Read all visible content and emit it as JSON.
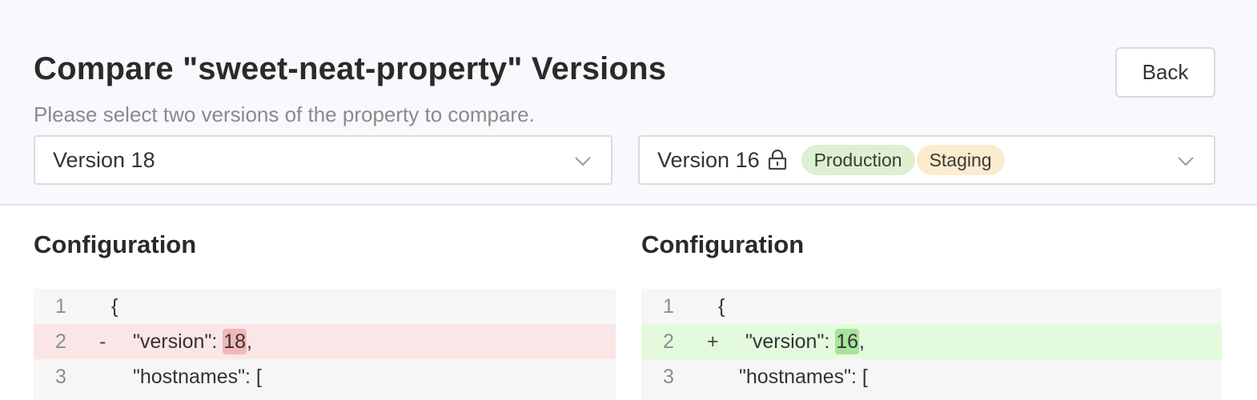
{
  "header": {
    "title": "Compare \"sweet-neat-property\" Versions",
    "subtitle": "Please select two versions of the property to compare.",
    "back_label": "Back"
  },
  "left_select": {
    "value": "Version 18",
    "icon": "chevron-down-icon"
  },
  "right_select": {
    "value": "Version 16",
    "lock_icon": "lock-icon",
    "tags": [
      "Production",
      "Staging"
    ],
    "icon": "chevron-down-icon"
  },
  "left_panel": {
    "title": "Configuration",
    "lines": [
      {
        "num": "1",
        "marker": "",
        "pre": "{",
        "hl": "",
        "post": ""
      },
      {
        "num": "2",
        "marker": "-",
        "pre": "\"version\": ",
        "hl": "18",
        "post": ","
      },
      {
        "num": "3",
        "marker": "",
        "pre": "\"hostnames\": [",
        "hl": "",
        "post": ""
      }
    ]
  },
  "right_panel": {
    "title": "Configuration",
    "lines": [
      {
        "num": "1",
        "marker": "",
        "pre": "{",
        "hl": "",
        "post": ""
      },
      {
        "num": "2",
        "marker": "+",
        "pre": "\"version\": ",
        "hl": "16",
        "post": ","
      },
      {
        "num": "3",
        "marker": "",
        "pre": "\"hostnames\": [",
        "hl": "",
        "post": ""
      }
    ]
  },
  "colors": {
    "deleted_line": "#fae6e6",
    "deleted_highlight": "#f3b7b7",
    "added_line": "#e3fadd",
    "added_highlight": "#a7e39d",
    "production_tag": "#ddf0d3",
    "staging_tag": "#fbebcf"
  }
}
